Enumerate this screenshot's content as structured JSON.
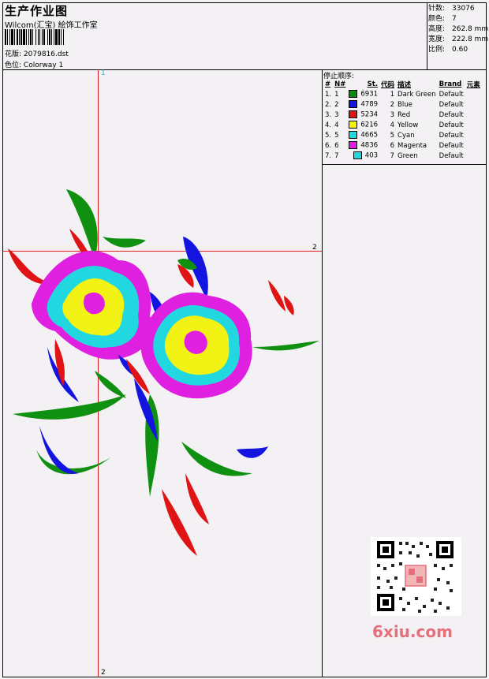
{
  "header": {
    "title": "生产作业图",
    "company": "Wilcom(汇宝) 絵饰工作室",
    "design_label": "花版:",
    "design_value": "2079816.dst",
    "colorway_label": "色位:",
    "colorway_value": "Colorway 1"
  },
  "stats": {
    "stitches_label": "针数:",
    "stitches": "33076",
    "colors_label": "颜色:",
    "colors": "7",
    "height_label": "高度:",
    "height": "262.8 mm",
    "width_label": "宽度:",
    "width": "222.8 mm",
    "scale_label": "比例:",
    "scale": "0.60"
  },
  "sequence": {
    "title": "停止顺序:",
    "columns": [
      "#",
      "N#",
      "St.",
      "代码",
      "描述",
      "Brand",
      "元素"
    ],
    "rows": [
      {
        "num": "1.",
        "n": "1",
        "color": "#0a8a0a",
        "st": "6931",
        "code": "1",
        "desc": "Dark Green",
        "brand": "Default"
      },
      {
        "num": "2.",
        "n": "2",
        "color": "#1414e0",
        "st": "4789",
        "code": "2",
        "desc": "Blue",
        "brand": "Default"
      },
      {
        "num": "3.",
        "n": "3",
        "color": "#e01414",
        "st": "5234",
        "code": "3",
        "desc": "Red",
        "brand": "Default"
      },
      {
        "num": "4.",
        "n": "4",
        "color": "#f2f214",
        "st": "6216",
        "code": "4",
        "desc": "Yellow",
        "brand": "Default"
      },
      {
        "num": "5.",
        "n": "5",
        "color": "#22d8e0",
        "st": "4665",
        "code": "5",
        "desc": "Cyan",
        "brand": "Default"
      },
      {
        "num": "6.",
        "n": "6",
        "color": "#e020e0",
        "st": "4836",
        "code": "6",
        "desc": "Magenta",
        "brand": "Default"
      },
      {
        "num": "7.",
        "n": "7",
        "color": "#22d8e0",
        "st": "403",
        "code": "7",
        "desc": "Green",
        "brand": "Default"
      }
    ]
  },
  "guides": {
    "v_top": "1",
    "h_right": "2",
    "v_bottom": "2"
  },
  "watermark": "6xiu.com"
}
